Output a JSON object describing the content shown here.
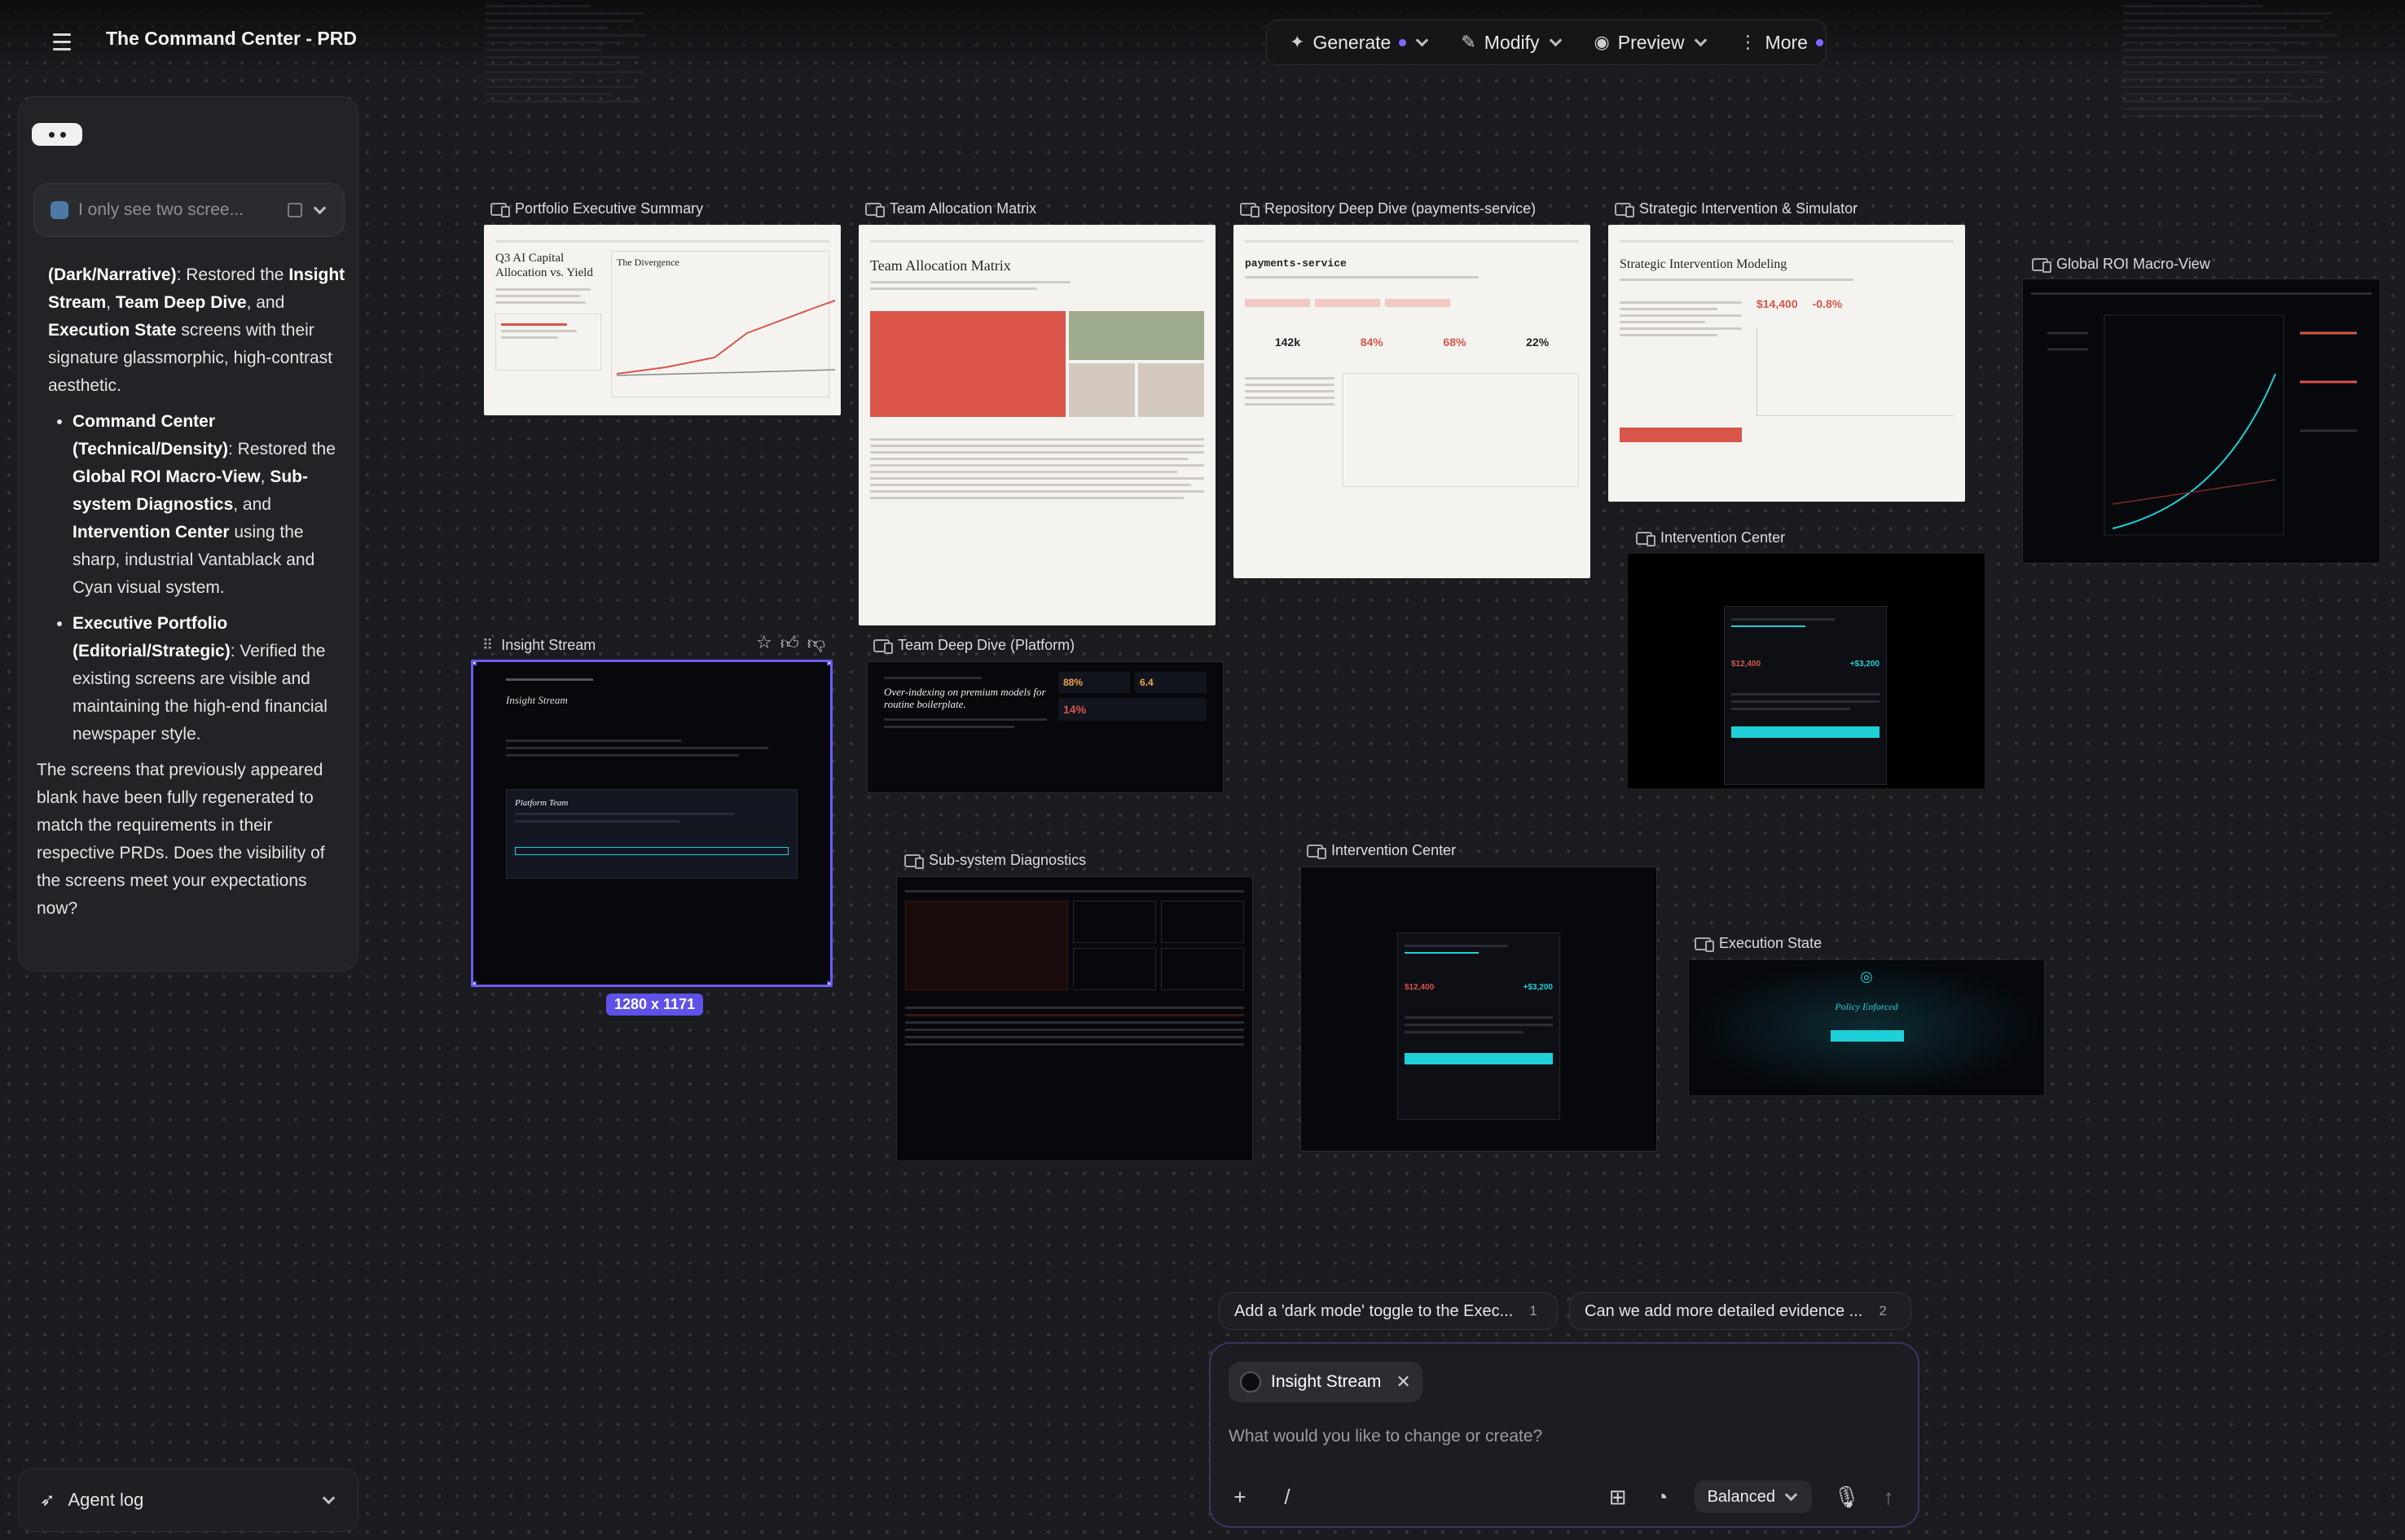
{
  "app": {
    "title": "The Command Center - PRD"
  },
  "toolbar": {
    "generate": "Generate",
    "modify": "Modify",
    "preview": "Preview",
    "more": "More"
  },
  "chat": {
    "quote": "I only see two scree...",
    "paragraph_start": "(Dark/Narrative)",
    "paragraph_start_rest": ": Restored the ",
    "p1_b1": "Insight Stream",
    "p1_t1": ", ",
    "p1_b2": "Team Deep Dive",
    "p1_t2": ", and ",
    "p1_b3": "Execution State",
    "p1_t3": " screens with their signature glassmorphic, high-contrast aesthetic.",
    "b2_title": "Command Center (Technical/Density)",
    "b2_t0": ": Restored the ",
    "b2_b1": "Global ROI Macro-View",
    "b2_t1": ", ",
    "b2_b2": "Sub-system Diagnostics",
    "b2_t2": ", and ",
    "b2_b3": "Intervention Center",
    "b2_t3": " using the sharp, industrial Vantablack and Cyan visual system.",
    "b3_title": "Executive Portfolio (Editorial/Strategic)",
    "b3_t0": ": Verified the existing screens are visible and maintaining the high-end financial newspaper style.",
    "closing": "The screens that previously appeared blank have been fully regenerated to match the requirements in their respective PRDs. Does the visibility of the screens meet your expectations now?"
  },
  "agent_log": {
    "label": "Agent log"
  },
  "frames": {
    "portfolio": "Portfolio Executive Summary",
    "team_alloc": "Team Allocation Matrix",
    "repo": "Repository Deep Dive (payments-service)",
    "strategic": "Strategic Intervention & Simulator",
    "global_roi": "Global ROI Macro-View",
    "intervention1": "Intervention Center",
    "insight": "Insight Stream",
    "team_deep": "Team Deep Dive (Platform)",
    "subsystem": "Sub-system Diagnostics",
    "intervention2": "Intervention Center",
    "execution": "Execution State"
  },
  "mini": {
    "q3_title": "Q3 AI Capital Allocation vs. Yield",
    "divergence": "The Divergence",
    "team_matrix_title": "Team Allocation Matrix",
    "payments": "payments-service",
    "strategic_title": "Strategic Intervention Modeling",
    "insight_title": "Insight Stream",
    "platform_team": "Platform Team",
    "overindex": "Over-indexing on premium models for routine boilerplate.",
    "pct88": "88%",
    "val64": "6.4",
    "pct14": "14%",
    "policy": "Policy Enforced",
    "stat142k": "142k",
    "stat84": "84%",
    "stat68": "68%",
    "stat22": "22%",
    "val14400": "$14,400",
    "neg08": "-0.8%",
    "val12400": "$12,400",
    "val3200": "+$3,200"
  },
  "selection": {
    "size": "1280 x 1171"
  },
  "suggestions": [
    {
      "text": "Add a 'dark mode' toggle to the Exec...",
      "num": "1"
    },
    {
      "text": "Can we add more detailed evidence ...",
      "num": "2"
    }
  ],
  "prompt": {
    "chip": "Insight Stream",
    "placeholder": "What would you like to change or create?",
    "mode": "Balanced"
  },
  "colors": {
    "accent": "#6b5cf6",
    "cyan": "#1fd0d8",
    "alert": "#d9554a"
  }
}
